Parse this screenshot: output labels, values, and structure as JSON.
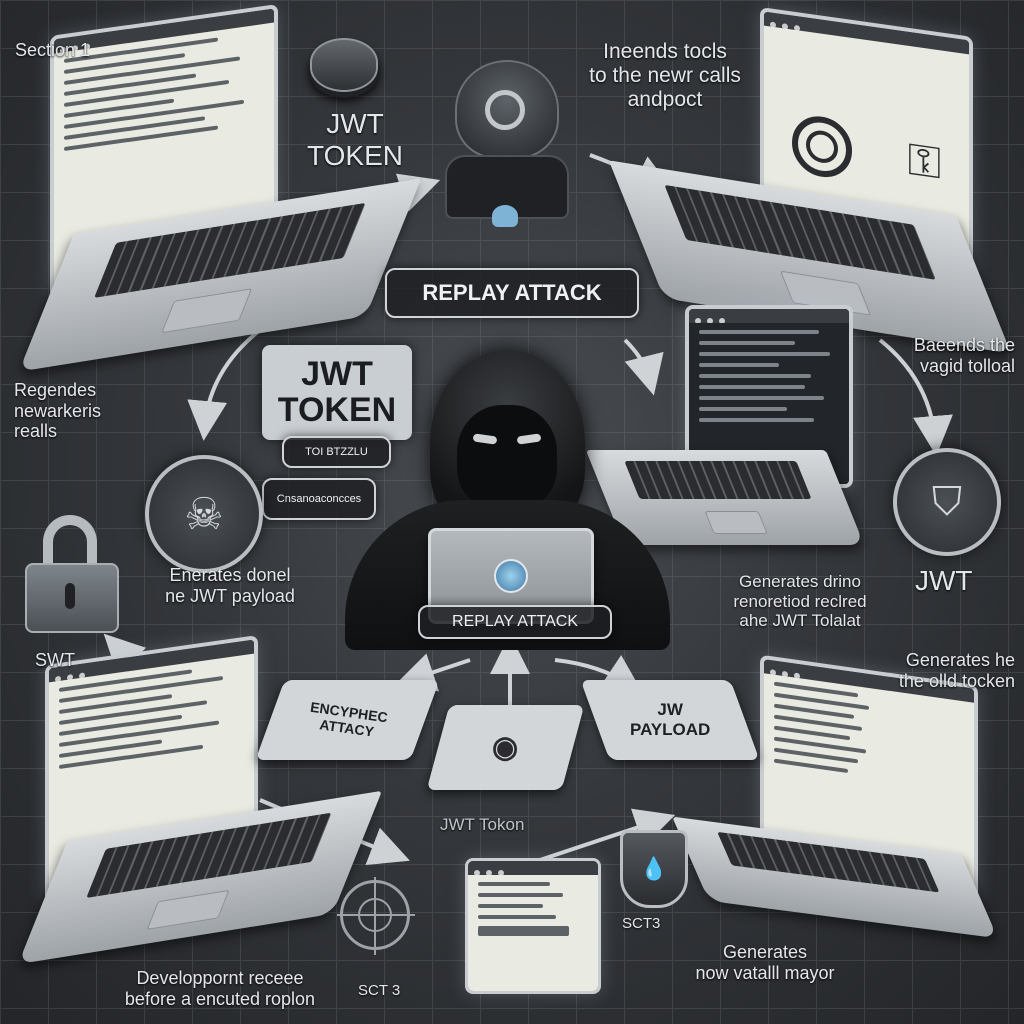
{
  "labels": {
    "section1": "Section 1",
    "jwt_token_top": "JWT\nTOKEN",
    "top_right": "Ineends tocls\nto the newr calls\nandpoct",
    "replay_attack_banner": "REPLAY ATTACK",
    "jwt_token_big": "JWT\nTOKEN",
    "jwt_chip_small_1": "TOI BTZZLU",
    "jwt_chip_small_2": "Cnsanoaconcces",
    "left_mid": "Regendes\nnewarkeris\nrealls",
    "right_mid": "Baeends the\nvagid tolloal",
    "left_gen": "Enerates donel\nne JWT payload",
    "right_gen": "Generates drino\nrenoretiod reclred\nahe JWT Tolalat",
    "jwt_right": "JWT",
    "swt_left": "SWT",
    "replay_attack_tablet": "REPLAY ATTACK",
    "card_left": "ENCYPHEC\nATTACY",
    "card_right": "JW\nPAYLOAD",
    "jwt_token_bottom": "JWT Tokon",
    "generates_right": "Generates he\nthe olld tocken",
    "bottom_left": "Developpornt receee\nbefore a encuted roplon",
    "sct3": "SCT 3",
    "sct_right": "SCT3",
    "bottom_right": "Generates\nnow vatalll mayor"
  },
  "icons": {
    "hacker_top": "hacker-helmet-icon",
    "hacker_center": "hooded-hacker-icon",
    "lock": "padlock-icon",
    "shield_right": "shield-icon",
    "shield_bottom": "shield-icon",
    "skull_circle": "skull-crossbones-icon",
    "target": "crosshair-icon",
    "token_disc": "token-disc-icon"
  },
  "colors": {
    "background": "#2b2d30",
    "accent": "#c9cdd1",
    "screen_glow": "#b4c8dc"
  }
}
